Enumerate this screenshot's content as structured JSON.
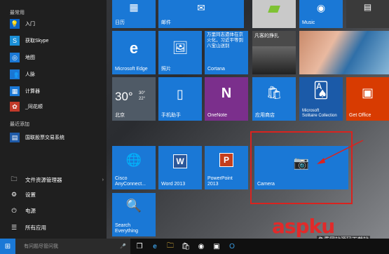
{
  "left": {
    "most_used_header": "最常用",
    "apps": [
      {
        "label": "入门",
        "icon": "lightbulb-icon",
        "color": "#0a64c8"
      },
      {
        "label": "获取Skype",
        "icon": "skype-icon",
        "color": "#1b8fd6"
      },
      {
        "label": "地图",
        "icon": "map-icon",
        "color": "#1a78d6"
      },
      {
        "label": "人脉",
        "icon": "people-icon",
        "color": "#1a78d6"
      },
      {
        "label": "计算器",
        "icon": "calculator-icon",
        "color": "#1a78d6"
      },
      {
        "label": "_同花顺",
        "icon": "flower-icon",
        "color": "#c23a2a"
      }
    ],
    "recent_header": "最近添加",
    "recent_app": {
      "label": "国联股票交易系统",
      "icon": "stock-icon",
      "color": "#1e5aa8"
    },
    "system": [
      {
        "label": "文件资源管理器",
        "icon": "folder-icon",
        "arrow": "›"
      },
      {
        "label": "设置",
        "icon": "gear-icon"
      },
      {
        "label": "电源",
        "icon": "power-icon"
      },
      {
        "label": "所有应用",
        "icon": "all-apps-icon"
      }
    ]
  },
  "tiles": {
    "calendar": "日历",
    "mail": "邮件",
    "music": "Music",
    "edge": "Microsoft Edge",
    "photos": "照片",
    "cortana_text": "万里同志遗体在京火化，习近平等到八宝山送别",
    "cortana": "Cortana",
    "ad_text": "凡客的挣扎",
    "weather_temp": "30°",
    "weather_hi": "30°",
    "weather_lo": "22°",
    "weather_city": "北京",
    "phone": "手机助手",
    "onenote": "OneNote",
    "store": "应用商店",
    "solitaire_1": "Microsoft",
    "solitaire_2": "Solitaire Collection",
    "office": "Get Office",
    "cisco_1": "Cisco",
    "cisco_2": "AnyConnect...",
    "word": "Word 2013",
    "ppt_1": "PowerPoint",
    "ppt_2": "2013",
    "camera": "Camera",
    "search_1": "Search",
    "search_2": "Everything"
  },
  "taskbar": {
    "search_placeholder": "有问题尽管问我"
  },
  "watermark": {
    "brand": "aspku",
    "sub": "免费网站源码下载站"
  },
  "colors": {
    "tile_blue": "#1a78d6",
    "onenote": "#7b2f8c",
    "office": "#d83b01",
    "word": "#2b579a",
    "ppt": "#c43e1c",
    "highlight": "#d9231f"
  }
}
